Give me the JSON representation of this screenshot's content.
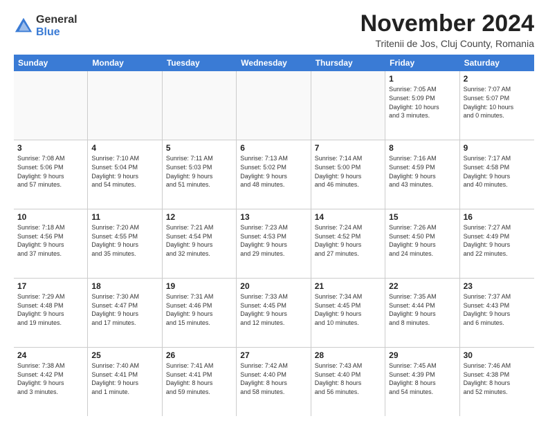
{
  "logo": {
    "general": "General",
    "blue": "Blue"
  },
  "title": "November 2024",
  "location": "Tritenii de Jos, Cluj County, Romania",
  "header_days": [
    "Sunday",
    "Monday",
    "Tuesday",
    "Wednesday",
    "Thursday",
    "Friday",
    "Saturday"
  ],
  "weeks": [
    [
      {
        "day": "",
        "info": "",
        "empty": true
      },
      {
        "day": "",
        "info": "",
        "empty": true
      },
      {
        "day": "",
        "info": "",
        "empty": true
      },
      {
        "day": "",
        "info": "",
        "empty": true
      },
      {
        "day": "",
        "info": "",
        "empty": true
      },
      {
        "day": "1",
        "info": "Sunrise: 7:05 AM\nSunset: 5:09 PM\nDaylight: 10 hours\nand 3 minutes.",
        "empty": false
      },
      {
        "day": "2",
        "info": "Sunrise: 7:07 AM\nSunset: 5:07 PM\nDaylight: 10 hours\nand 0 minutes.",
        "empty": false
      }
    ],
    [
      {
        "day": "3",
        "info": "Sunrise: 7:08 AM\nSunset: 5:06 PM\nDaylight: 9 hours\nand 57 minutes.",
        "empty": false
      },
      {
        "day": "4",
        "info": "Sunrise: 7:10 AM\nSunset: 5:04 PM\nDaylight: 9 hours\nand 54 minutes.",
        "empty": false
      },
      {
        "day": "5",
        "info": "Sunrise: 7:11 AM\nSunset: 5:03 PM\nDaylight: 9 hours\nand 51 minutes.",
        "empty": false
      },
      {
        "day": "6",
        "info": "Sunrise: 7:13 AM\nSunset: 5:02 PM\nDaylight: 9 hours\nand 48 minutes.",
        "empty": false
      },
      {
        "day": "7",
        "info": "Sunrise: 7:14 AM\nSunset: 5:00 PM\nDaylight: 9 hours\nand 46 minutes.",
        "empty": false
      },
      {
        "day": "8",
        "info": "Sunrise: 7:16 AM\nSunset: 4:59 PM\nDaylight: 9 hours\nand 43 minutes.",
        "empty": false
      },
      {
        "day": "9",
        "info": "Sunrise: 7:17 AM\nSunset: 4:58 PM\nDaylight: 9 hours\nand 40 minutes.",
        "empty": false
      }
    ],
    [
      {
        "day": "10",
        "info": "Sunrise: 7:18 AM\nSunset: 4:56 PM\nDaylight: 9 hours\nand 37 minutes.",
        "empty": false
      },
      {
        "day": "11",
        "info": "Sunrise: 7:20 AM\nSunset: 4:55 PM\nDaylight: 9 hours\nand 35 minutes.",
        "empty": false
      },
      {
        "day": "12",
        "info": "Sunrise: 7:21 AM\nSunset: 4:54 PM\nDaylight: 9 hours\nand 32 minutes.",
        "empty": false
      },
      {
        "day": "13",
        "info": "Sunrise: 7:23 AM\nSunset: 4:53 PM\nDaylight: 9 hours\nand 29 minutes.",
        "empty": false
      },
      {
        "day": "14",
        "info": "Sunrise: 7:24 AM\nSunset: 4:52 PM\nDaylight: 9 hours\nand 27 minutes.",
        "empty": false
      },
      {
        "day": "15",
        "info": "Sunrise: 7:26 AM\nSunset: 4:50 PM\nDaylight: 9 hours\nand 24 minutes.",
        "empty": false
      },
      {
        "day": "16",
        "info": "Sunrise: 7:27 AM\nSunset: 4:49 PM\nDaylight: 9 hours\nand 22 minutes.",
        "empty": false
      }
    ],
    [
      {
        "day": "17",
        "info": "Sunrise: 7:29 AM\nSunset: 4:48 PM\nDaylight: 9 hours\nand 19 minutes.",
        "empty": false
      },
      {
        "day": "18",
        "info": "Sunrise: 7:30 AM\nSunset: 4:47 PM\nDaylight: 9 hours\nand 17 minutes.",
        "empty": false
      },
      {
        "day": "19",
        "info": "Sunrise: 7:31 AM\nSunset: 4:46 PM\nDaylight: 9 hours\nand 15 minutes.",
        "empty": false
      },
      {
        "day": "20",
        "info": "Sunrise: 7:33 AM\nSunset: 4:45 PM\nDaylight: 9 hours\nand 12 minutes.",
        "empty": false
      },
      {
        "day": "21",
        "info": "Sunrise: 7:34 AM\nSunset: 4:45 PM\nDaylight: 9 hours\nand 10 minutes.",
        "empty": false
      },
      {
        "day": "22",
        "info": "Sunrise: 7:35 AM\nSunset: 4:44 PM\nDaylight: 9 hours\nand 8 minutes.",
        "empty": false
      },
      {
        "day": "23",
        "info": "Sunrise: 7:37 AM\nSunset: 4:43 PM\nDaylight: 9 hours\nand 6 minutes.",
        "empty": false
      }
    ],
    [
      {
        "day": "24",
        "info": "Sunrise: 7:38 AM\nSunset: 4:42 PM\nDaylight: 9 hours\nand 3 minutes.",
        "empty": false
      },
      {
        "day": "25",
        "info": "Sunrise: 7:40 AM\nSunset: 4:41 PM\nDaylight: 9 hours\nand 1 minute.",
        "empty": false
      },
      {
        "day": "26",
        "info": "Sunrise: 7:41 AM\nSunset: 4:41 PM\nDaylight: 8 hours\nand 59 minutes.",
        "empty": false
      },
      {
        "day": "27",
        "info": "Sunrise: 7:42 AM\nSunset: 4:40 PM\nDaylight: 8 hours\nand 58 minutes.",
        "empty": false
      },
      {
        "day": "28",
        "info": "Sunrise: 7:43 AM\nSunset: 4:40 PM\nDaylight: 8 hours\nand 56 minutes.",
        "empty": false
      },
      {
        "day": "29",
        "info": "Sunrise: 7:45 AM\nSunset: 4:39 PM\nDaylight: 8 hours\nand 54 minutes.",
        "empty": false
      },
      {
        "day": "30",
        "info": "Sunrise: 7:46 AM\nSunset: 4:38 PM\nDaylight: 8 hours\nand 52 minutes.",
        "empty": false
      }
    ]
  ]
}
